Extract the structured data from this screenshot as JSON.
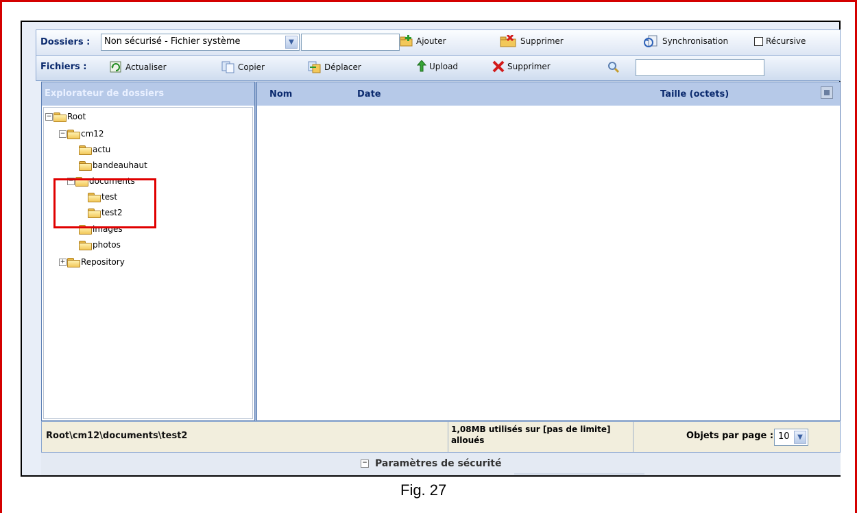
{
  "toolbar_folders": {
    "label": "Dossiers :",
    "source_select": "Non sécurisé - Fichier système",
    "folder_name_value": "",
    "add_label": "Ajouter",
    "delete_label": "Supprimer",
    "sync_label": "Synchronisation",
    "recursive_label": "Récursive",
    "recursive_checked": false
  },
  "toolbar_files": {
    "label": "Fichiers :",
    "refresh_label": "Actualiser",
    "copy_label": "Copier",
    "move_label": "Déplacer",
    "upload_label": "Upload",
    "delete_label": "Supprimer",
    "search_value": ""
  },
  "explorer": {
    "title": "Explorateur de dossiers",
    "tree": [
      "Root",
      "cm12",
      "actu",
      "bandeauhaut",
      "documents",
      "test",
      "test2",
      "images",
      "photos",
      "Repository"
    ]
  },
  "grid": {
    "col_name": "Nom",
    "col_date": "Date",
    "col_size": "Taille (octets)"
  },
  "status": {
    "path": "Root\\cm12\\documents\\test2",
    "usage": "1,08MB utilisés sur [pas de limite] alloués",
    "per_page_label": "Objets par page :",
    "per_page_value": "10"
  },
  "security": {
    "title": "Paramètres de sécurité"
  },
  "caption": "Fig. 27",
  "colors": {
    "annotation_red": "#e00000",
    "header_blue": "#b6c9e8",
    "label_navy": "#0b2a6e"
  }
}
